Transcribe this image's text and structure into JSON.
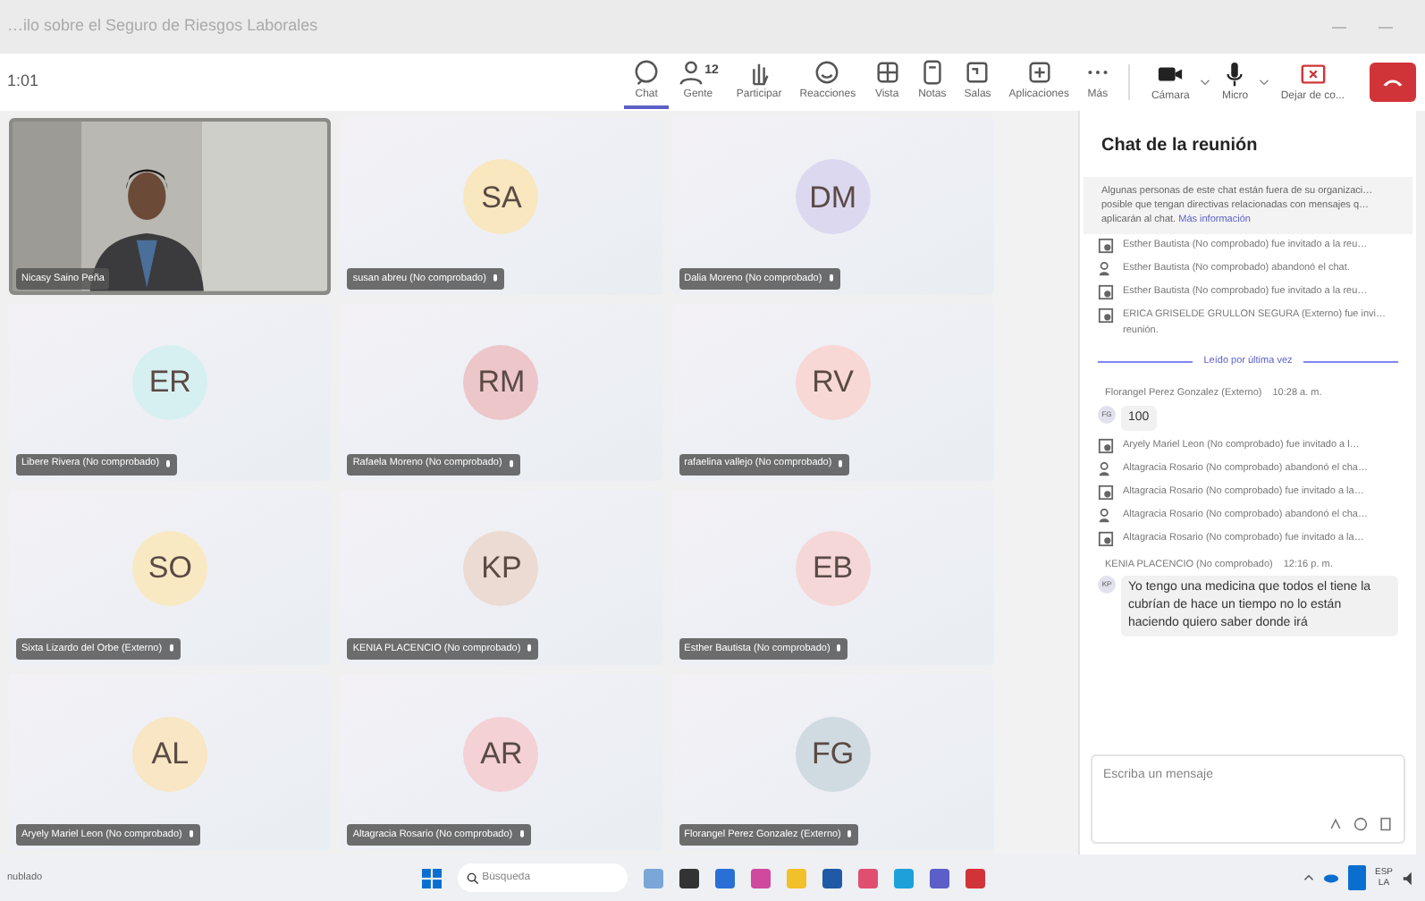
{
  "window": {
    "title": "…ilo sobre el Seguro de Riesgos Laborales",
    "timer": "1:01"
  },
  "toolbar": [
    {
      "label": "Chat",
      "selected": true
    },
    {
      "label": "Gente",
      "badge": "12",
      "selected": false
    },
    {
      "label": "Participar",
      "selected": false
    },
    {
      "label": "Reacciones",
      "selected": false
    },
    {
      "label": "Vista",
      "selected": false
    },
    {
      "label": "Notas",
      "selected": false
    },
    {
      "label": "Salas",
      "selected": false
    },
    {
      "label": "Aplicaciones",
      "selected": false
    },
    {
      "label": "Más",
      "selected": false
    }
  ],
  "media_controls": [
    {
      "label": "Cámara"
    },
    {
      "label": "Micro"
    },
    {
      "label": "Dejar de co..."
    }
  ],
  "video_participant": {
    "name": "Nicasy Saino Peña"
  },
  "participants": [
    {
      "name": "susan abreu (No comprobado)",
      "initials": "SA",
      "color": "#f8e7bf",
      "kind": "avatar"
    },
    {
      "name": "Dalia Moreno (No comprobado)",
      "initials": "DM",
      "color": "#dcd8f0",
      "kind": "avatar"
    },
    {
      "name": "Libere Rivera (No comprobado)",
      "initials": "ER",
      "color": "#d6f0f2",
      "kind": "avatar"
    },
    {
      "name": "Rafaela Moreno (No comprobado)",
      "initials": "RM",
      "color": "#ecc6c9",
      "kind": "avatar"
    },
    {
      "name": "rafaelina vallejo (No comprobado)",
      "initials": "RV",
      "color": "#f7d8d4",
      "kind": "avatar"
    },
    {
      "name": "Sixta Lizardo del Orbe (Externo)",
      "initials": "SO",
      "color": "#f9e9c3",
      "kind": "avatar"
    },
    {
      "name": "KENIA PLACENCIO (No comprobado)",
      "initials": "KP",
      "color": "#ebdbd2",
      "kind": "avatar"
    },
    {
      "name": "Esther Bautista (No comprobado)",
      "initials": "EB",
      "color": "#f6d7d7",
      "kind": "avatar"
    },
    {
      "name": "Aryely Mariel Leon (No comprobado)",
      "initials": "AL",
      "color": "#f8e6c4",
      "kind": "avatar"
    },
    {
      "name": "Altagracia Rosario (No comprobado)",
      "initials": "AR",
      "color": "#f3d1d4",
      "kind": "avatar"
    },
    {
      "name": "Florangel Perez Gonzalez (Externo)",
      "initials": "FG",
      "color": "#d0dae1",
      "kind": "avatar"
    }
  ],
  "chat": {
    "title": "Chat de la reunión",
    "notice": "Algunas personas de este chat están fuera de su organizaci… posible que tengan directivas relacionadas con mensajes q… aplicarán al chat.",
    "notice_link": "Más información",
    "items": [
      {
        "kind": "invite",
        "text": "Esther Bautista (No comprobado) fue invitado a la reu…"
      },
      {
        "kind": "left",
        "text": "Esther Bautista (No comprobado) abandonó el chat."
      },
      {
        "kind": "invite",
        "text": "Esther Bautista (No comprobado) fue invitado a la reu…"
      },
      {
        "kind": "invite",
        "text": "ERICA GRISELDE GRULLON SEGURA (Externo) fue invi… reunión."
      },
      {
        "kind": "divider",
        "text": "Leído por última vez"
      },
      {
        "kind": "message",
        "author": "Florangel Perez Gonzalez (Externo)",
        "time": "10:28 a. m.",
        "initials": "FG",
        "text": "100"
      },
      {
        "kind": "invite",
        "text": "Aryely Mariel Leon (No comprobado) fue invitado a l…"
      },
      {
        "kind": "left",
        "text": "Altagracia Rosario (No comprobado) abandonó el cha…"
      },
      {
        "kind": "invite",
        "text": "Altagracia Rosario (No comprobado) fue invitado a la…"
      },
      {
        "kind": "left",
        "text": "Altagracia Rosario (No comprobado) abandonó el cha…"
      },
      {
        "kind": "invite",
        "text": "Altagracia Rosario (No comprobado) fue invitado a la…"
      },
      {
        "kind": "message",
        "author": "KENIA PLACENCIO (No comprobado)",
        "time": "12:16 p. m.",
        "initials": "KP",
        "text": "Yo tengo una medicina que todos el tiene la cubrían de hace un tiempo no lo están haciendo quiero saber donde irá"
      }
    ],
    "compose_placeholder": "Escriba un mensaje"
  },
  "taskbar": {
    "weather": "nublado",
    "search_placeholder": "Búsqueda",
    "language": "ESP",
    "layout": "LA"
  }
}
